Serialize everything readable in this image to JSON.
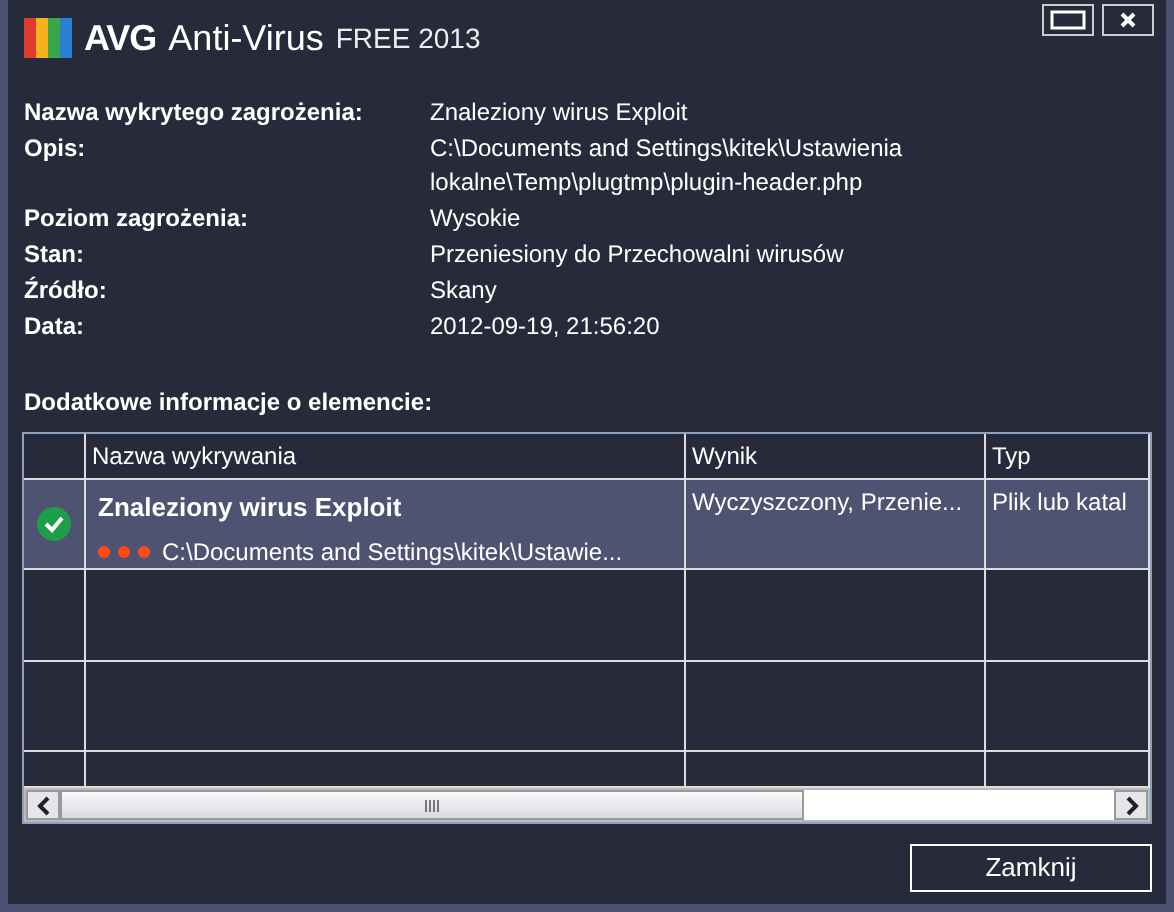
{
  "window": {
    "brand": "AVG",
    "product": "Anti-Virus",
    "edition": "FREE 2013"
  },
  "details": [
    {
      "label": "Nazwa wykrytego zagrożenia:",
      "value": "Znaleziony wirus Exploit"
    },
    {
      "label": "Opis:",
      "value": "C:\\Documents and Settings\\kitek\\Ustawienia lokalne\\Temp\\plugtmp\\plugin-header.php"
    },
    {
      "label": "Poziom zagrożenia:",
      "value": "Wysokie"
    },
    {
      "label": "Stan:",
      "value": "Przeniesiony do Przechowalni wirusów"
    },
    {
      "label": "Źródło:",
      "value": "Skany"
    },
    {
      "label": "Data:",
      "value": "2012-09-19, 21:56:20"
    }
  ],
  "section_title": "Dodatkowe informacje o elemencie:",
  "table": {
    "columns": [
      "Nazwa wykrywania",
      "Wynik",
      "Typ"
    ],
    "rows": [
      {
        "selected": true,
        "name": "Znaleziony wirus Exploit",
        "path": "C:\\Documents and Settings\\kitek\\Ustawie...",
        "result": "Wyczyszczony, Przenie...",
        "type": "Plik lub katal"
      }
    ]
  },
  "buttons": [
    "Zamknij"
  ]
}
